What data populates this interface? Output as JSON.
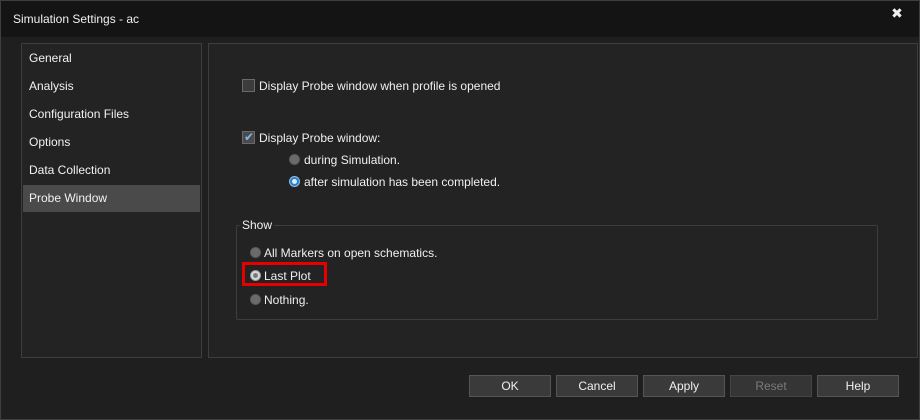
{
  "window": {
    "title": "Simulation Settings - ac",
    "close_glyph": "✖"
  },
  "sidebar": {
    "items": [
      {
        "label": "General"
      },
      {
        "label": "Analysis"
      },
      {
        "label": "Configuration Files"
      },
      {
        "label": "Options"
      },
      {
        "label": "Data Collection"
      },
      {
        "label": "Probe Window",
        "selected": true
      }
    ]
  },
  "probe_window": {
    "open_on_profile": {
      "label": "Display Probe window when profile is opened",
      "checked": false
    },
    "display_probe": {
      "label": "Display Probe window:",
      "checked": true
    },
    "timing_options": [
      {
        "label": "during Simulation.",
        "selected": false
      },
      {
        "label": "after simulation has been completed.",
        "selected": true
      }
    ],
    "show_group": {
      "title": "Show",
      "options": [
        {
          "label": "All Markers on open schematics.",
          "selected": false
        },
        {
          "label": "Last Plot",
          "selected": true
        },
        {
          "label": "Nothing.",
          "selected": false
        }
      ]
    }
  },
  "buttons": {
    "ok": "OK",
    "cancel": "Cancel",
    "apply": "Apply",
    "reset": "Reset",
    "help": "Help"
  },
  "colors": {
    "accent": "#2f7dc4",
    "highlight": "#e60000",
    "selected_item": "#4a4a4a"
  }
}
